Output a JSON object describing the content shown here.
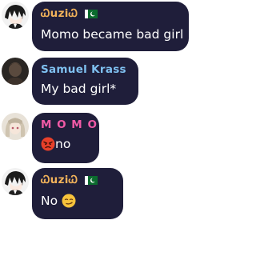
{
  "messages": [
    {
      "sender": "ᏇuziᏇ",
      "flag": "pakistan-flag",
      "sender_color": "#f1b25a",
      "text": "Momo became bad girl"
    },
    {
      "sender": "Samuel Krass",
      "sender_color": "#7fc0f0",
      "text": "My bad girl*"
    },
    {
      "sender": "M O M O",
      "sender_color": "#f05aa6",
      "emoji": "angry-face-emoji",
      "text": "no"
    },
    {
      "sender": "ᏇuziᏇ",
      "flag": "pakistan-flag",
      "sender_color": "#f1b25a",
      "text": "No",
      "emoji": "smirk-face-emoji"
    }
  ],
  "colors": {
    "bubble": "#1f1e3a",
    "background": "#ffffff"
  }
}
